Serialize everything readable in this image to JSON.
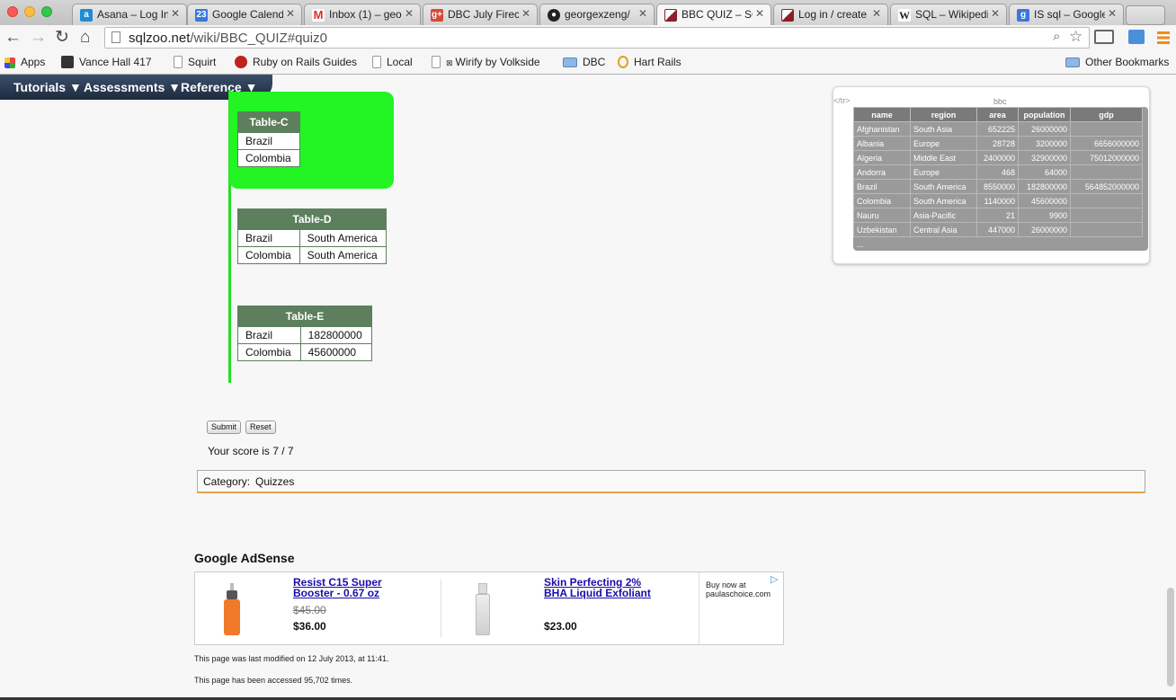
{
  "tabs": [
    {
      "label": "Asana – Log In",
      "icon": "asana-icon",
      "color": "#1e8cd3"
    },
    {
      "label": "Google Calend",
      "icon": "calendar-icon",
      "color": "#3b77db"
    },
    {
      "label": "Inbox (1) – geo",
      "icon": "gmail-icon",
      "color": "#d93025"
    },
    {
      "label": "DBC July Firecr",
      "icon": "google-plus-icon",
      "color": "#d64937"
    },
    {
      "label": "georgexzeng/",
      "icon": "github-icon",
      "color": "#222222"
    },
    {
      "label": "BBC QUIZ – SQ",
      "icon": "sqlzoo-icon",
      "color": "#8b1f2b",
      "active": true
    },
    {
      "label": "Log in / create",
      "icon": "sqlzoo-icon",
      "color": "#8b1f2b"
    },
    {
      "label": "SQL – Wikipedi",
      "icon": "wikipedia-icon",
      "color": "#444444"
    },
    {
      "label": "IS sql – Google",
      "icon": "google-search-icon",
      "color": "#3b77db"
    }
  ],
  "address": {
    "host": "sqlzoo.net",
    "path": "/wiki/BBC_QUIZ#quiz0"
  },
  "bookmarks": [
    {
      "label": "Apps",
      "icon": "apps-grid-icon"
    },
    {
      "label": "Vance Hall 417",
      "icon": "sqlzoo-icon"
    },
    {
      "label": "Squirt",
      "icon": "page-icon"
    },
    {
      "label": "Ruby on Rails Guides",
      "icon": "rails-icon"
    },
    {
      "label": "Local",
      "icon": "page-icon"
    },
    {
      "label": "Wirify by Volkside",
      "icon": "page-icon"
    },
    {
      "label": "DBC",
      "icon": "folder-icon"
    },
    {
      "label": "Hart Rails",
      "icon": "hart-icon"
    },
    {
      "label": "Other Bookmarks",
      "icon": "folder-icon"
    }
  ],
  "nav": {
    "tutorials": "Tutorials ▼",
    "assessments": "Assessments ▼",
    "reference": "Reference ▼"
  },
  "table_c": {
    "title": "Table-C",
    "rows": [
      "Brazil",
      "Colombia"
    ]
  },
  "table_d": {
    "title": "Table-D",
    "rows": [
      [
        "Brazil",
        "South America"
      ],
      [
        "Colombia",
        "South America"
      ]
    ]
  },
  "table_e": {
    "title": "Table-E",
    "rows": [
      [
        "Brazil",
        "182800000"
      ],
      [
        "Colombia",
        "45600000"
      ]
    ]
  },
  "bbc": {
    "tr_tag": "</tr>",
    "caption": "bbc",
    "headers": [
      "name",
      "region",
      "area",
      "population",
      "gdp"
    ],
    "rows": [
      [
        "Afghanistan",
        "South Asia",
        "652225",
        "26000000",
        ""
      ],
      [
        "Albania",
        "Europe",
        "28728",
        "3200000",
        "6656000000"
      ],
      [
        "Algeria",
        "Middle East",
        "2400000",
        "32900000",
        "75012000000"
      ],
      [
        "Andorra",
        "Europe",
        "468",
        "64000",
        ""
      ],
      [
        "Brazil",
        "South America",
        "8550000",
        "182800000",
        "564852000000"
      ],
      [
        "Colombia",
        "South America",
        "1140000",
        "45600000",
        ""
      ],
      [
        "Nauru",
        "Asia-Pacific",
        "21",
        "9900",
        ""
      ],
      [
        "Uzbekistan",
        "Central Asia",
        "447000",
        "26000000",
        ""
      ]
    ],
    "ellipsis": "..."
  },
  "buttons": {
    "submit": "Submit",
    "reset": "Reset"
  },
  "score": "Your score is 7 / 7",
  "category": {
    "label": "Category:",
    "value": "Quizzes"
  },
  "adsense": {
    "title": "Google AdSense",
    "ad1": {
      "title_line1": "Resist C15 Super",
      "title_line2": "Booster - 0.67 oz",
      "old_price": "$45.00",
      "price": "$36.00"
    },
    "ad2": {
      "title_line1": "Skin Perfecting 2%",
      "title_line2": "BHA Liquid Exfoliant",
      "price": "$23.00"
    },
    "buy_line1": "Buy now at",
    "buy_line2": "paulaschoice.com"
  },
  "footer": {
    "modified": "This page was last modified on 12 July 2013, at 11:41.",
    "accessed": "This page has been accessed 95,702 times."
  }
}
